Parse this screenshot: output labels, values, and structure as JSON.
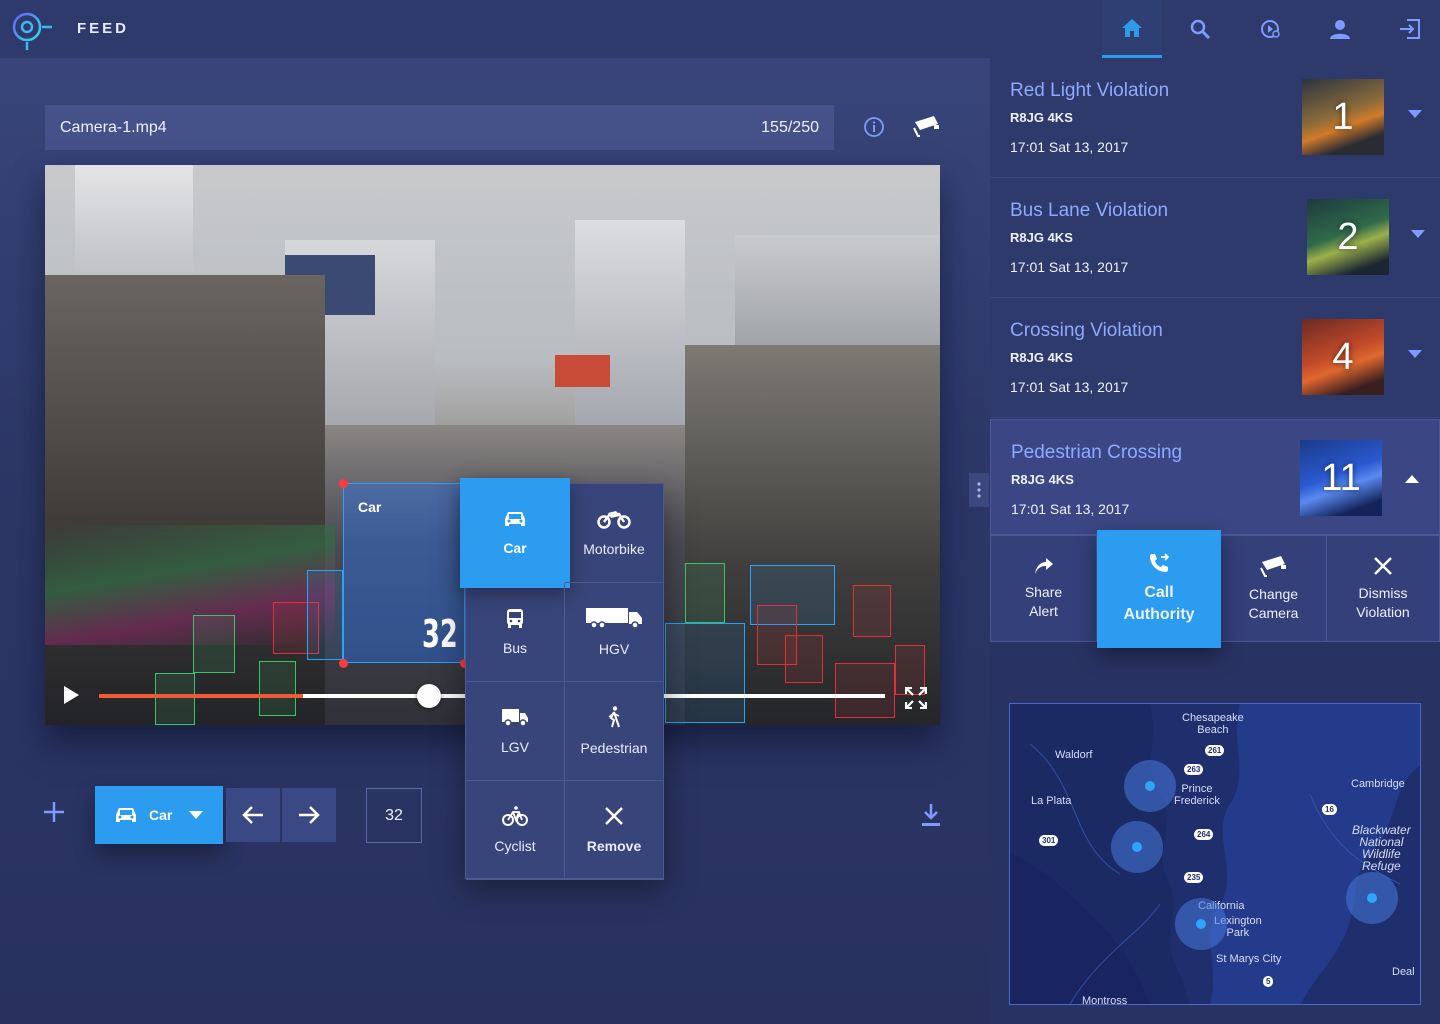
{
  "app": {
    "title": "FEED"
  },
  "nav": {
    "items": [
      {
        "name": "home-icon",
        "active": true
      },
      {
        "name": "search-icon"
      },
      {
        "name": "video-add-icon"
      },
      {
        "name": "user-icon"
      },
      {
        "name": "logout-icon"
      }
    ]
  },
  "player": {
    "file_name": "Camera-1.mp4",
    "frame_count": "155/250",
    "buffered_fraction": 0.26,
    "position_fraction": 0.42
  },
  "selection": {
    "label": "Car",
    "id": "32"
  },
  "class_menu": {
    "items": [
      {
        "label": "Car",
        "icon": "car-icon",
        "active": true
      },
      {
        "label": "Motorbike",
        "icon": "motorbike-icon"
      },
      {
        "label": "Bus",
        "icon": "bus-icon"
      },
      {
        "label": "HGV",
        "icon": "truck-icon"
      },
      {
        "label": "LGV",
        "icon": "van-icon"
      },
      {
        "label": "Pedestrian",
        "icon": "pedestrian-icon"
      },
      {
        "label": "Cyclist",
        "icon": "bicycle-icon"
      },
      {
        "label": "Remove",
        "icon": "close-icon"
      }
    ]
  },
  "toolbar": {
    "class_value": "Car",
    "object_id": "32"
  },
  "alerts": [
    {
      "title": "Red Light Violation",
      "plate": "R8JG 4KS",
      "time": "17:01 Sat 13, 2017",
      "thumb_num": "1",
      "expanded": false
    },
    {
      "title": "Bus Lane Violation",
      "plate": "R8JG 4KS",
      "time": "17:01 Sat 13, 2017",
      "thumb_num": "2",
      "expanded": false
    },
    {
      "title": "Crossing Violation",
      "plate": "R8JG 4KS",
      "time": "17:01 Sat 13, 2017",
      "thumb_num": "4",
      "expanded": false
    },
    {
      "title": "Pedestrian Crossing",
      "plate": "R8JG 4KS",
      "time": "17:01 Sat 13, 2017",
      "thumb_num": "11",
      "expanded": true
    }
  ],
  "alert_actions": [
    {
      "line1": "Share",
      "line2": "Alert",
      "icon": "share-icon"
    },
    {
      "line1": "Call",
      "line2": "Authority",
      "icon": "call-forward-icon",
      "primary": true
    },
    {
      "line1": "Change",
      "line2": "Camera",
      "icon": "cctv-camera-icon"
    },
    {
      "line1": "Dismiss",
      "line2": "Violation",
      "icon": "close-icon"
    }
  ],
  "map": {
    "labels": {
      "chesapeake_1": "Chesapeake",
      "chesapeake_2": "Beach",
      "waldorf": "Waldorf",
      "cambridge": "Cambridge",
      "la_plata": "La Plata",
      "prince_1": "Prince",
      "prince_2": "Frederick",
      "blackwater_1": "Blackwater",
      "blackwater_2": "National",
      "blackwater_3": "Wildlife",
      "blackwater_4": "Refuge",
      "california": "California",
      "lexington_1": "Lexington",
      "lexington_2": "Park",
      "st_marys": "St Marys City",
      "montross": "Montross",
      "deal": "Deal"
    },
    "routes": [
      "261",
      "263",
      "264",
      "301",
      "16",
      "235",
      "5"
    ]
  },
  "colors": {
    "accent": "#2c9cf0",
    "background": "#26305c",
    "alert_title": "#8ea9ff",
    "progress": "#f05a34"
  }
}
